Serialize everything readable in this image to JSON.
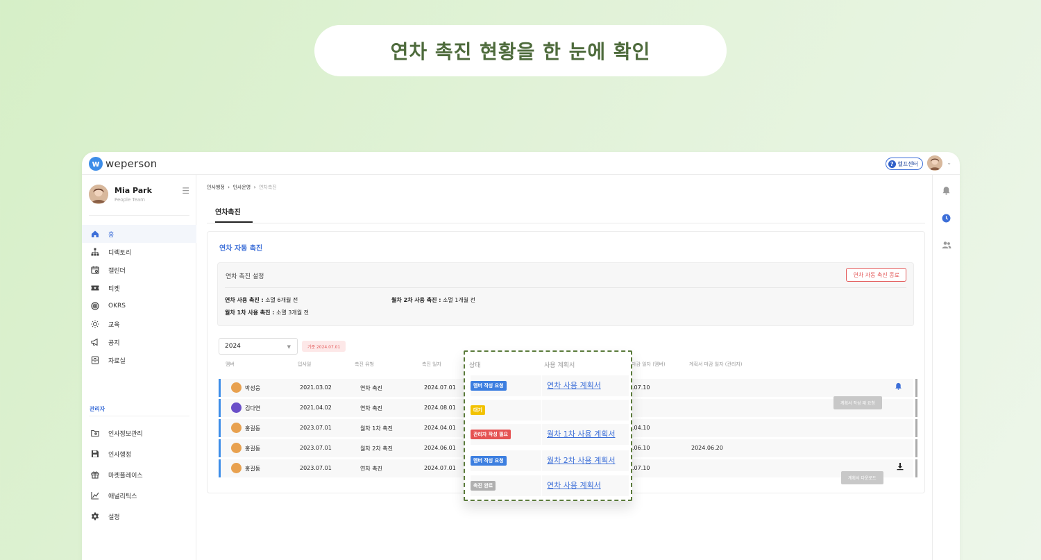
{
  "headline": "연차 촉진 현황을 한 눈에 확인",
  "app": {
    "logo_mark": "w",
    "logo_text": "weperson",
    "help_label": "헬프센터"
  },
  "profile": {
    "name": "Mia Park",
    "team": "People Team"
  },
  "nav": {
    "items": [
      {
        "label": "홈",
        "icon": "home-icon"
      },
      {
        "label": "디렉토리",
        "icon": "org-chart-icon"
      },
      {
        "label": "캘린더",
        "icon": "calendar-icon"
      },
      {
        "label": "티켓",
        "icon": "ticket-icon"
      },
      {
        "label": "OKRS",
        "icon": "target-icon"
      },
      {
        "label": "교육",
        "icon": "bulb-icon"
      },
      {
        "label": "공지",
        "icon": "megaphone-icon"
      },
      {
        "label": "자료실",
        "icon": "archive-icon"
      }
    ],
    "admin_section": "관리자",
    "admin_items": [
      {
        "label": "인사정보관리",
        "icon": "folder-icon"
      },
      {
        "label": "인사행정",
        "icon": "save-icon"
      },
      {
        "label": "마켓플레이스",
        "icon": "gift-icon"
      },
      {
        "label": "애널리틱스",
        "icon": "analytics-icon"
      },
      {
        "label": "설정",
        "icon": "gear-icon"
      }
    ]
  },
  "breadcrumb": {
    "a": "인사행정",
    "b": "인사운영",
    "c": "연차촉진"
  },
  "tab": "연차촉진",
  "card": {
    "title": "연차 자동 촉진",
    "settings_title": "연차 촉진 설정",
    "end_button": "연차 자동 촉진 종료",
    "s1_label": "연차 사용 촉진 :",
    "s1_value": "소멸 6개월 전",
    "s2_label": "월차 2차 사용 촉진 :",
    "s2_value": "소멸 1개월 전",
    "s3_label": "월차 1차 사용 촉진 :",
    "s3_value": "소멸 3개월 전"
  },
  "filter": {
    "year": "2024",
    "date_badge": "기준 2024.07.01"
  },
  "table": {
    "headers": {
      "member": "멤버",
      "join": "입사일",
      "type": "촉진 유형",
      "date": "촉진 일자",
      "deadline_member": "마감 일자 (멤버)",
      "deadline_admin": "계획서 마감 일자 (관리자)"
    },
    "rows": [
      {
        "name": "박성웅",
        "join": "2021.03.02",
        "type": "연차 촉진",
        "date": "2024.07.01",
        "deadline": ".07.10",
        "admin": ""
      },
      {
        "name": "김다연",
        "join": "2021.04.02",
        "type": "연차 촉진",
        "date": "2024.08.01",
        "deadline": "",
        "admin": ""
      },
      {
        "name": "홍길동",
        "join": "2023.07.01",
        "type": "월차 1차 촉진",
        "date": "2024.04.01",
        "deadline": ".04.10",
        "admin": ""
      },
      {
        "name": "홍길동",
        "join": "2023.07.01",
        "type": "월차 2차 촉진",
        "date": "2024.06.01",
        "deadline": ".06.10",
        "admin": "2024.06.20"
      },
      {
        "name": "홍길동",
        "join": "2023.07.01",
        "type": "연차 촉진",
        "date": "2024.07.01",
        "deadline": ".07.10",
        "admin": ""
      }
    ],
    "rerequest_button": "계획서 작성 재 요청",
    "download_button": "계획서 다운로드"
  },
  "overlay": {
    "header_status": "상태",
    "header_plan": "사용 계획서",
    "rows": [
      {
        "status": "멤버 작성 요청",
        "color": "#3d7fe0",
        "plan": "연차 사용 계획서"
      },
      {
        "status": "대기",
        "color": "#f2c200",
        "plan": ""
      },
      {
        "status": "관리자 작성 필요",
        "color": "#e55353",
        "plan": "월차 1차 사용 계획서"
      },
      {
        "status": "멤버 작성 요청",
        "color": "#3d7fe0",
        "plan": "월차 2차 사용 계획서"
      },
      {
        "status": "촉진 완료",
        "color": "#b0b0b0",
        "plan": "연차 사용 계획서"
      }
    ]
  }
}
